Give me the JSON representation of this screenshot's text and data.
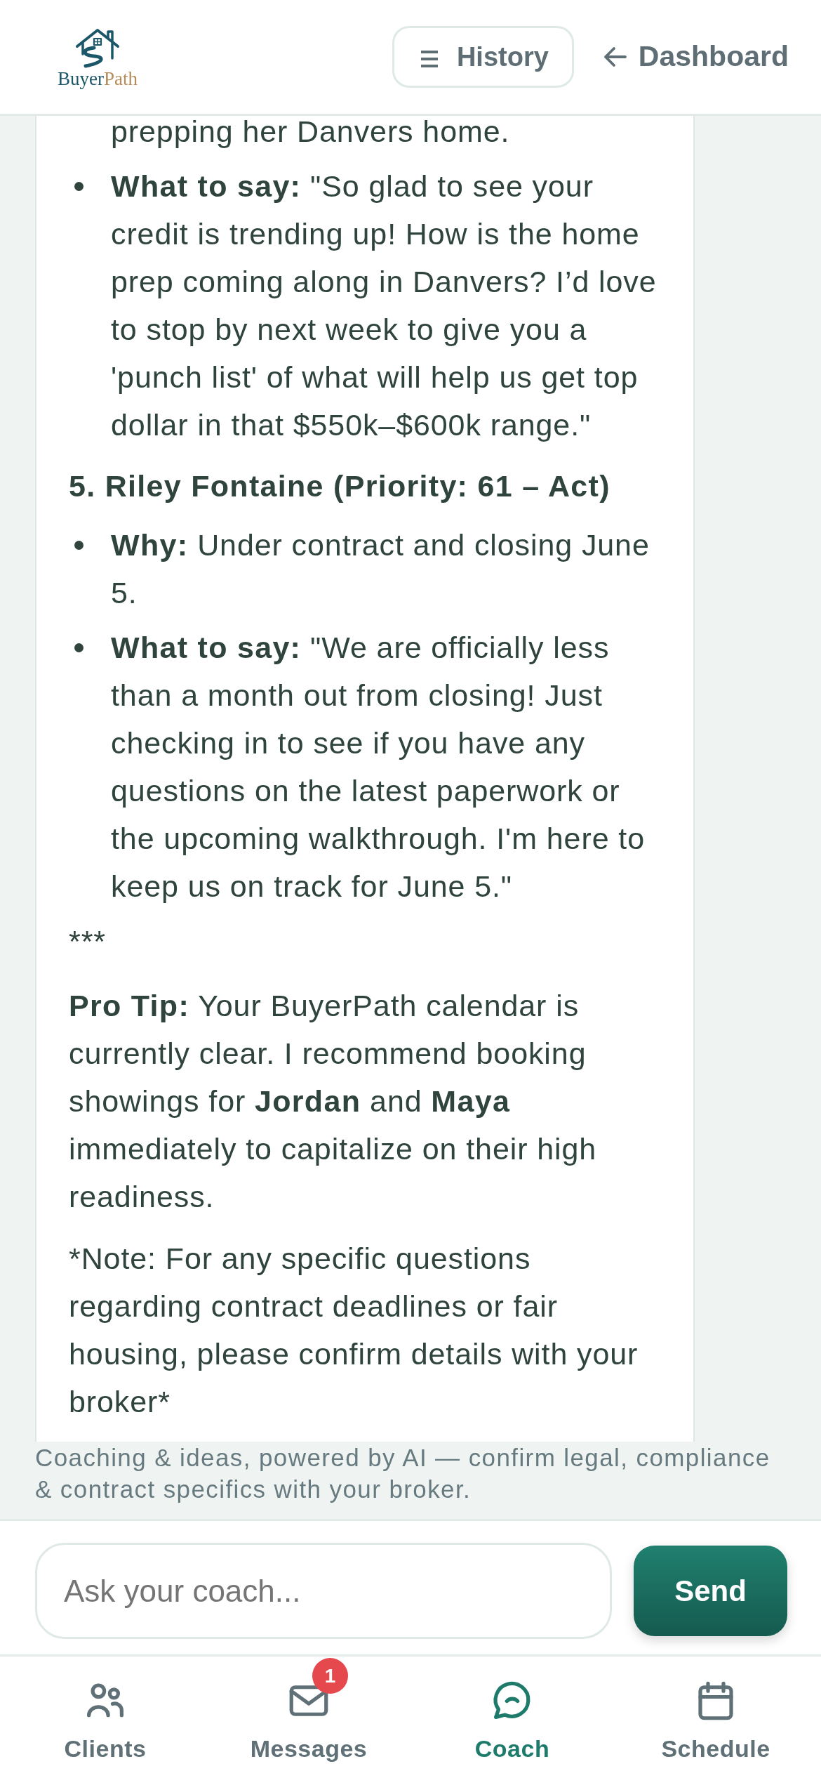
{
  "header": {
    "logo": {
      "first_word": "Buyer",
      "second_word": "Path"
    },
    "history_button": "History",
    "dashboard_link": "Dashboard"
  },
  "message": {
    "blocks": [
      {
        "kind": "continuation",
        "text": "prepping her Danvers home."
      },
      {
        "kind": "bullet",
        "text": "**What to say:** \"So glad to see your credit is trending up! How is the home prep coming along in Danvers? I’d love to stop by next week to give you a 'punch list' of what will help us get top dollar in that $550k–$600k range.\""
      },
      {
        "kind": "heading",
        "text": "5. Riley Fontaine (Priority: 61 – Act)"
      },
      {
        "kind": "bullet",
        "text": "**Why:** Under contract and closing June 5."
      },
      {
        "kind": "bullet",
        "text": "**What to say:** \"We are officially less than a month out from closing! Just checking in to see if you have any questions on the latest paperwork or the upcoming walkthrough. I'm here to keep us on track for June 5.\""
      },
      {
        "kind": "divider",
        "text": "***"
      },
      {
        "kind": "paragraph",
        "text": "**Pro Tip:** Your BuyerPath calendar is currently clear. I recommend booking showings for **Jordan** and **Maya** immediately to capitalize on their high readiness."
      },
      {
        "kind": "note",
        "text": "*Note: For any specific questions regarding contract deadlines or fair housing, please confirm details with your broker*"
      }
    ]
  },
  "disclaimer": "Coaching & ideas, powered by AI — confirm legal, compliance & contract specifics with your broker.",
  "composer": {
    "placeholder": "Ask your coach...",
    "send_button": "Send"
  },
  "bottom_nav": [
    {
      "label": "Clients",
      "selected": false
    },
    {
      "label": "Messages",
      "selected": false,
      "badge": "1"
    },
    {
      "label": "Coach",
      "selected": true
    },
    {
      "label": "Schedule",
      "selected": false
    }
  ]
}
